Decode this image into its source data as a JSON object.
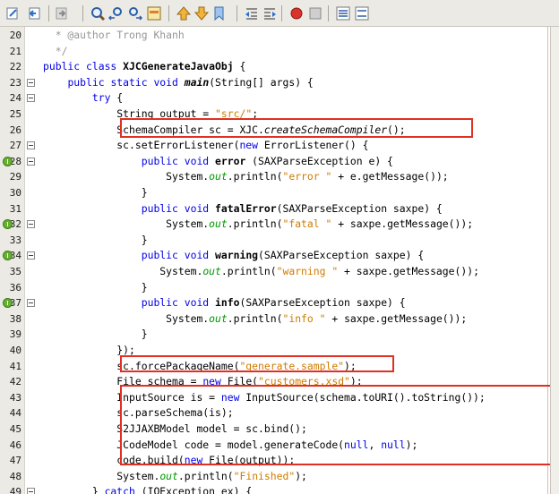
{
  "toolbar": {
    "buttons": [
      {
        "icon": "last-edit-icon"
      },
      {
        "icon": "back-icon"
      },
      {
        "icon": "forward-icon"
      },
      {
        "icon": "find-icon"
      },
      {
        "icon": "find-previous-icon"
      },
      {
        "icon": "find-next-icon"
      },
      {
        "icon": "toggle-highlight-icon"
      },
      {
        "icon": "previous-bookmark-icon"
      },
      {
        "icon": "next-bookmark-icon"
      },
      {
        "icon": "toggle-bookmark-icon"
      },
      {
        "icon": "shift-left-icon"
      },
      {
        "icon": "shift-right-icon"
      },
      {
        "icon": "start-macro-icon"
      },
      {
        "icon": "stop-macro-icon"
      },
      {
        "icon": "comment-icon"
      },
      {
        "icon": "uncomment-icon"
      }
    ]
  },
  "lines": [
    {
      "num": "20",
      "tokens": [
        {
          "t": "  * @author Trong Khanh",
          "c": "cm"
        }
      ]
    },
    {
      "num": "21",
      "tokens": [
        {
          "t": "  */",
          "c": "cm"
        }
      ]
    },
    {
      "num": "22",
      "tokens": [
        {
          "t": "public class ",
          "c": "kw"
        },
        {
          "t": "XJCGenerateJavaObj",
          "c": "bold"
        },
        {
          "t": " {"
        }
      ]
    },
    {
      "num": "23",
      "fold": true,
      "tokens": [
        {
          "t": "    "
        },
        {
          "t": "public static void ",
          "c": "kw"
        },
        {
          "t": "main",
          "c": "bold it"
        },
        {
          "t": "(String[] args) {"
        }
      ]
    },
    {
      "num": "24",
      "fold": true,
      "tokens": [
        {
          "t": "        "
        },
        {
          "t": "try",
          "c": "kw"
        },
        {
          "t": " {"
        }
      ]
    },
    {
      "num": "25",
      "tokens": [
        {
          "t": "            String output = "
        },
        {
          "t": "\"src/\"",
          "c": "str"
        },
        {
          "t": ";"
        }
      ]
    },
    {
      "num": "26",
      "tokens": [
        {
          "t": "            SchemaCompiler sc = XJC."
        },
        {
          "t": "createSchemaCompiler",
          "c": "it"
        },
        {
          "t": "();"
        }
      ]
    },
    {
      "num": "27",
      "fold": true,
      "tokens": [
        {
          "t": "            sc.setErrorListener("
        },
        {
          "t": "new",
          "c": "kw"
        },
        {
          "t": " ErrorListener() {"
        }
      ]
    },
    {
      "num": "28",
      "override": true,
      "fold": true,
      "tokens": [
        {
          "t": "                "
        },
        {
          "t": "public void ",
          "c": "kw"
        },
        {
          "t": "error",
          "c": "bold"
        },
        {
          "t": " (SAXParseException e) {"
        }
      ]
    },
    {
      "num": "29",
      "tokens": [
        {
          "t": "                    System."
        },
        {
          "t": "out",
          "c": "st"
        },
        {
          "t": ".println("
        },
        {
          "t": "\"error \"",
          "c": "str"
        },
        {
          "t": " + e.getMessage());"
        }
      ]
    },
    {
      "num": "30",
      "tokens": [
        {
          "t": "                }"
        }
      ]
    },
    {
      "num": "31",
      "tokens": [
        {
          "t": "                "
        },
        {
          "t": "public void ",
          "c": "kw"
        },
        {
          "t": "fatalError",
          "c": "bold"
        },
        {
          "t": "(SAXParseException saxpe) {"
        }
      ]
    },
    {
      "num": "32",
      "override": true,
      "fold": true,
      "tokens": [
        {
          "t": "                    System."
        },
        {
          "t": "out",
          "c": "st"
        },
        {
          "t": ".println("
        },
        {
          "t": "\"fatal \"",
          "c": "str"
        },
        {
          "t": " + saxpe.getMessage());"
        }
      ]
    },
    {
      "num": "33",
      "tokens": [
        {
          "t": "                }"
        }
      ]
    },
    {
      "num": "34",
      "override": true,
      "fold": true,
      "tokens": [
        {
          "t": "                "
        },
        {
          "t": "public void ",
          "c": "kw"
        },
        {
          "t": "warning",
          "c": "bold"
        },
        {
          "t": "(SAXParseException saxpe) {"
        }
      ]
    },
    {
      "num": "35",
      "tokens": [
        {
          "t": "                   System."
        },
        {
          "t": "out",
          "c": "st"
        },
        {
          "t": ".println("
        },
        {
          "t": "\"warning \"",
          "c": "str"
        },
        {
          "t": " + saxpe.getMessage());"
        }
      ]
    },
    {
      "num": "36",
      "tokens": [
        {
          "t": "                }"
        }
      ]
    },
    {
      "num": "37",
      "override": true,
      "fold": true,
      "tokens": [
        {
          "t": "                "
        },
        {
          "t": "public void ",
          "c": "kw"
        },
        {
          "t": "info",
          "c": "bold"
        },
        {
          "t": "(SAXParseException saxpe) {"
        }
      ]
    },
    {
      "num": "38",
      "tokens": [
        {
          "t": "                    System."
        },
        {
          "t": "out",
          "c": "st"
        },
        {
          "t": ".println("
        },
        {
          "t": "\"info \"",
          "c": "str"
        },
        {
          "t": " + saxpe.getMessage());"
        }
      ]
    },
    {
      "num": "39",
      "tokens": [
        {
          "t": "                }"
        }
      ]
    },
    {
      "num": "40",
      "tokens": [
        {
          "t": "            });"
        }
      ]
    },
    {
      "num": "41",
      "tokens": [
        {
          "t": "            sc.forcePackageName("
        },
        {
          "t": "\"generate.sample\"",
          "c": "str"
        },
        {
          "t": ");"
        }
      ]
    },
    {
      "num": "42",
      "tokens": [
        {
          "t": "            File schema = "
        },
        {
          "t": "new",
          "c": "kw"
        },
        {
          "t": " File("
        },
        {
          "t": "\"customers.xsd\"",
          "c": "str"
        },
        {
          "t": ");"
        }
      ]
    },
    {
      "num": "43",
      "tokens": [
        {
          "t": "            InputSource is = "
        },
        {
          "t": "new",
          "c": "kw"
        },
        {
          "t": " InputSource(schema.toURI().toString());"
        }
      ]
    },
    {
      "num": "44",
      "tokens": [
        {
          "t": "            sc.parseSchema(is);"
        }
      ]
    },
    {
      "num": "45",
      "tokens": [
        {
          "t": "            S2JJAXBModel model = sc.bind();"
        }
      ]
    },
    {
      "num": "46",
      "tokens": [
        {
          "t": "            JCodeModel code = model.generateCode("
        },
        {
          "t": "null",
          "c": "kw"
        },
        {
          "t": ", "
        },
        {
          "t": "null",
          "c": "kw"
        },
        {
          "t": ");"
        }
      ]
    },
    {
      "num": "47",
      "tokens": [
        {
          "t": "            code.build("
        },
        {
          "t": "new",
          "c": "kw"
        },
        {
          "t": " File(output));"
        }
      ]
    },
    {
      "num": "48",
      "tokens": [
        {
          "t": "            System."
        },
        {
          "t": "out",
          "c": "st"
        },
        {
          "t": ".println("
        },
        {
          "t": "\"Finished\"",
          "c": "str"
        },
        {
          "t": ");"
        }
      ]
    },
    {
      "num": "49",
      "fold": true,
      "tokens": [
        {
          "t": "        } "
        },
        {
          "t": "catch",
          "c": "kw"
        },
        {
          "t": " (IOException ex) {"
        }
      ]
    }
  ],
  "colors": {
    "keyword": "#0000e6",
    "string": "#ce7b00",
    "comment": "#969696",
    "static_field": "#009900",
    "highlight_box": "#e03023",
    "override_badge": "#66b032",
    "gutter": "#eceae5"
  }
}
